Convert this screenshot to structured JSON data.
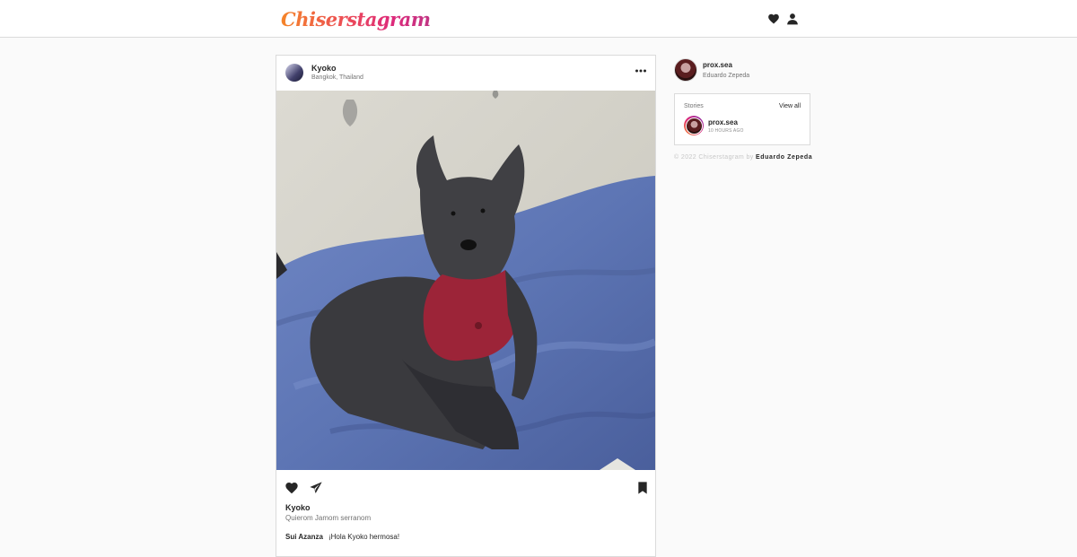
{
  "header": {
    "logo_text": "Chiserstagram",
    "icons": [
      "heart-icon",
      "user-icon"
    ]
  },
  "post": {
    "username": "Kyoko",
    "location": "Bangkok, Thailand",
    "more_icon": "ellipsis-icon",
    "photo_subject": "small black terrier with a red harness on a blue blanket",
    "action_icons": [
      "heart-icon",
      "paper-plane-icon",
      "bookmark-icon"
    ],
    "caption_user": "Kyoko",
    "caption_text": "Quierom Jamom serranom",
    "comment_user": "Sui Azanza",
    "comment_text": "¡Hola Kyoko hermosa!"
  },
  "sidebar": {
    "profile_username": "prox.sea",
    "profile_fullname": "Eduardo Zepeda",
    "stories_title": "Stories",
    "stories_view_all": "View all",
    "story_user": "prox.sea",
    "story_time": "10 HOURS AGO",
    "footer_prefix": "© 2022 Chiserstagram by",
    "footer_author": "Eduardo Zepeda"
  },
  "colors": {
    "logo_gradient": [
      "#f58529",
      "#dd2a7b",
      "#c13584"
    ],
    "border": "#dbdbdb",
    "background": "#fafafa",
    "text": "#262626",
    "muted": "#737373"
  }
}
